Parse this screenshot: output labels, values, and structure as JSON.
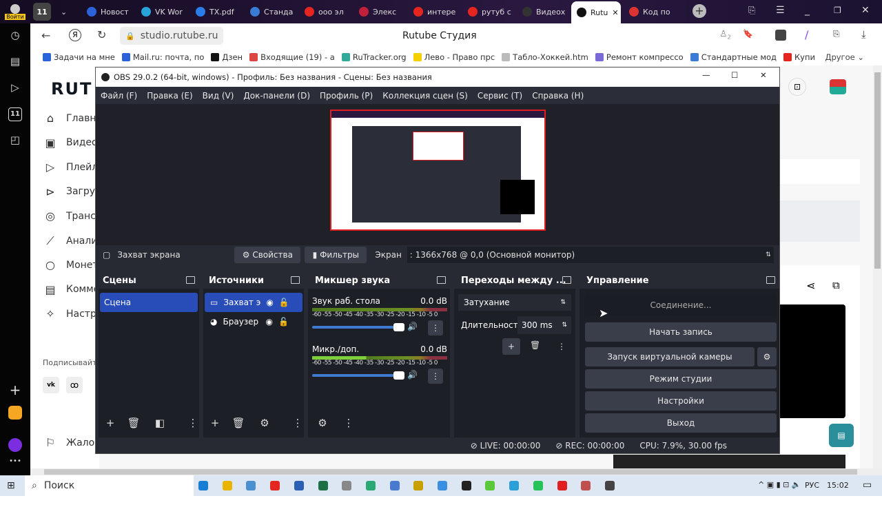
{
  "browser": {
    "tabs": [
      {
        "label": "Войти",
        "color": "#f5c518"
      },
      {
        "label": "11",
        "color": "#666"
      },
      {
        "label": "Новост",
        "color": "#2b62d9"
      },
      {
        "label": "VK Wor",
        "color": "#27a4d8"
      },
      {
        "label": "TX.pdf",
        "color": "#2b7de9"
      },
      {
        "label": "Станда",
        "color": "#3a7bd5"
      },
      {
        "label": "ооо эл",
        "color": "#e52620"
      },
      {
        "label": "Элекс",
        "color": "#c0203a"
      },
      {
        "label": "интере",
        "color": "#e52620"
      },
      {
        "label": "рутуб с",
        "color": "#e52620"
      },
      {
        "label": "Видеох",
        "color": "#333"
      },
      {
        "label": "Rutu",
        "color": "#111",
        "active": true
      },
      {
        "label": "Код по",
        "color": "#d33"
      }
    ],
    "address": "studio.rutube.ru",
    "page_title": "Rutube Студия",
    "downloads_badge": "2",
    "bookmarks": [
      {
        "label": "Задачи на мне",
        "color": "#2b62d9"
      },
      {
        "label": "Mail.ru: почта, по",
        "color": "#2b62d9"
      },
      {
        "label": "Дзен",
        "color": "#111"
      },
      {
        "label": "Входящие (19) - а",
        "color": "#d44"
      },
      {
        "label": "RuTracker.org",
        "color": "#3a9"
      },
      {
        "label": "Лево - Право прс",
        "color": "#f5d000"
      },
      {
        "label": "Табло-Хоккей.htm",
        "color": "#bbb"
      },
      {
        "label": "Ремонт компрессо",
        "color": "#7a6ad8"
      },
      {
        "label": "Стандартные мод",
        "color": "#3a7bd5"
      },
      {
        "label": "Купи",
        "color": "#e52620"
      }
    ],
    "other_bookmarks": "Другое"
  },
  "rutube": {
    "logo": "RUT",
    "nav": [
      {
        "label": "Главна",
        "icon": "home-icon"
      },
      {
        "label": "Видео",
        "icon": "video-icon"
      },
      {
        "label": "Плейлі",
        "icon": "playlist-icon"
      },
      {
        "label": "Загруз",
        "icon": "upload-icon"
      },
      {
        "label": "Трансл",
        "icon": "broadcast-icon"
      },
      {
        "label": "Аналит",
        "icon": "analytics-icon"
      },
      {
        "label": "Монет",
        "icon": "money-icon"
      },
      {
        "label": "Комме",
        "icon": "comments-icon"
      },
      {
        "label": "Настро",
        "icon": "settings-icon"
      }
    ],
    "subscribe": "Подписывайт",
    "social": [
      "vk",
      "ok"
    ],
    "complaint": "Жалоб"
  },
  "obs": {
    "title": "OBS 29.0.2 (64-bit, windows) - Профиль: Без названия - Сцены: Без названия",
    "menu": [
      "Файл (F)",
      "Правка (E)",
      "Вид (V)",
      "Док-панели (D)",
      "Профиль (P)",
      "Коллекция сцен (S)",
      "Сервис (T)",
      "Справка (H)"
    ],
    "source_bar": {
      "source": "Захват экрана",
      "properties": "Свойства",
      "filters": "Фильтры",
      "screen_label": "Экран",
      "screen_value": ": 1366x768 @ 0,0 (Основной монитор)"
    },
    "scenes": {
      "title": "Сцены",
      "items": [
        "Сцена"
      ]
    },
    "sources": {
      "title": "Источники",
      "items": [
        "Захват эк",
        "Браузер"
      ]
    },
    "mixer": {
      "title": "Микшер звука",
      "scale": "-60 -55 -50 -45 -40 -35 -30 -25 -20 -15 -10 -5 0",
      "channels": [
        {
          "name": "Звук раб. стола",
          "db": "0.0 dB",
          "volume": 1.0
        },
        {
          "name": "Микр./доп.",
          "db": "0.0 dB",
          "volume": 1.0
        }
      ]
    },
    "transitions": {
      "title": "Переходы между ...",
      "selected": "Затухание",
      "duration_label": "Длительность",
      "duration": "300 ms"
    },
    "controls": {
      "title": "Управление",
      "buttons": [
        "Соединение...",
        "Начать запись",
        "Запуск виртуальной камеры",
        "Режим студии",
        "Настройки",
        "Выход"
      ]
    },
    "status": {
      "live": "LIVE: 00:00:00",
      "rec": "REC: 00:00:00",
      "cpu": "CPU: 7.9%, 30.00 fps"
    }
  },
  "taskbar": {
    "search": "Поиск",
    "lang": "РУС",
    "time": "15:02"
  }
}
